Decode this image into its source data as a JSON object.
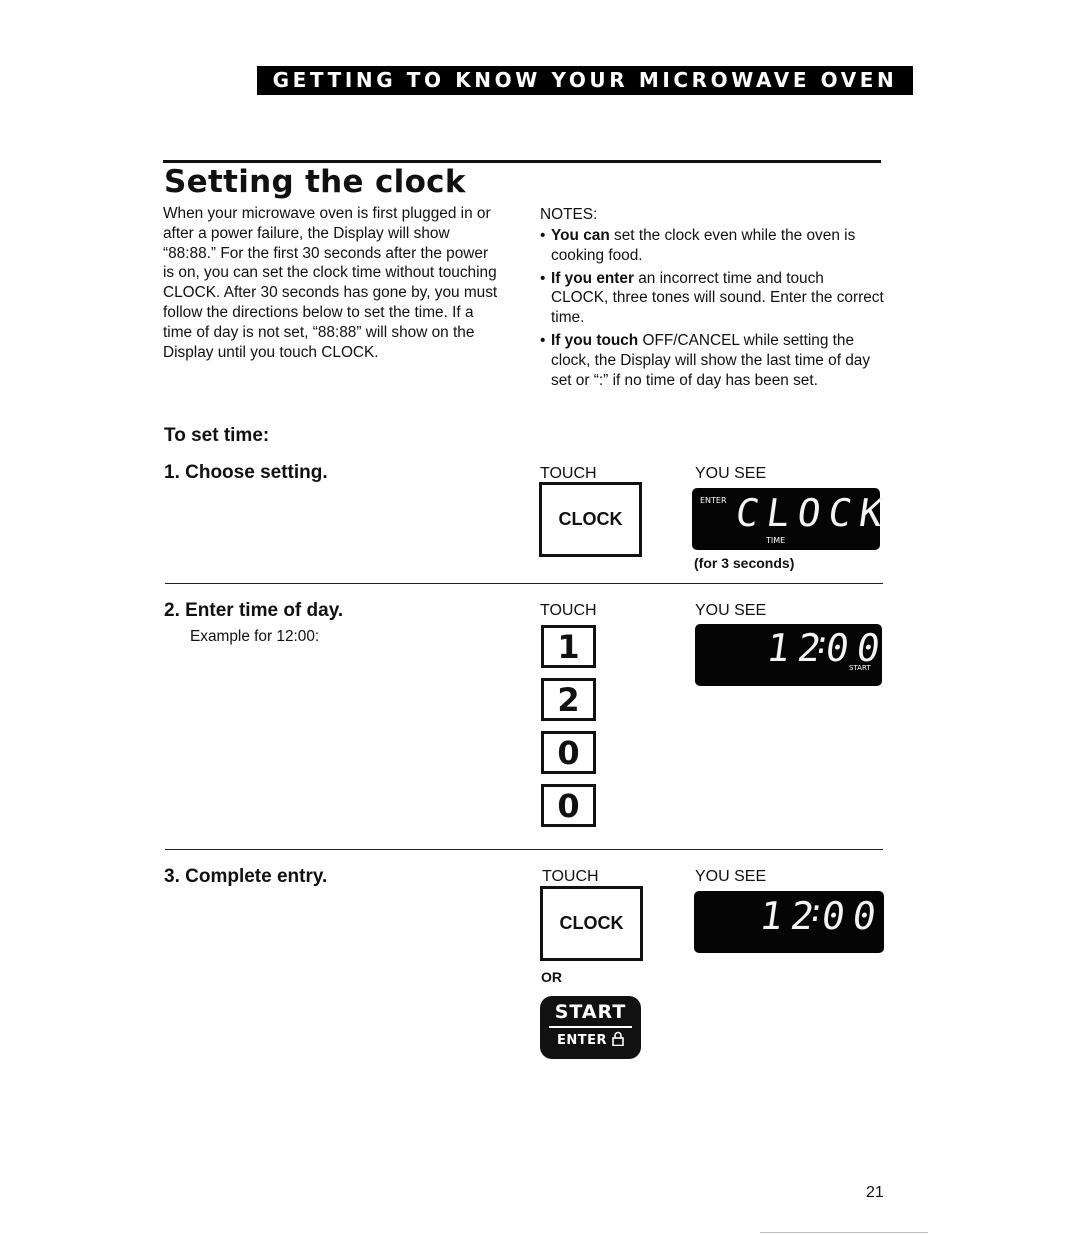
{
  "header": {
    "banner": "GETTING TO KNOW YOUR MICROWAVE OVEN"
  },
  "section": {
    "title": "Setting the clock",
    "intro": "When your microwave oven is first plugged in or after a power failure, the Display will show “88:88.” For the first 30 seconds after the power is on, you can set the clock time without touching CLOCK. After 30 seconds has gone by, you must follow the directions below to set the time. If a time of day is not set, “88:88” will show on the Display until you touch CLOCK."
  },
  "notes": {
    "heading": "NOTES:",
    "items": [
      {
        "bold": "You can",
        "text": " set the clock even while the oven is cooking food."
      },
      {
        "bold": "If you enter",
        "text": " an incorrect time and touch CLOCK, three tones will sound. Enter the correct time."
      },
      {
        "bold": "If you touch",
        "text": " OFF/CANCEL while setting the clock, the Display will show the last time of day set or “:” if no time of day has been set."
      }
    ]
  },
  "procedure": {
    "heading": "To set time:",
    "touch_label": "TOUCH",
    "you_see_label": "YOU SEE",
    "steps": [
      {
        "title": "1. Choose setting.",
        "key": "CLOCK",
        "display": {
          "text": "CLOCK",
          "indicator_top": "ENTER",
          "indicator_bottom": "TIME"
        },
        "caption": "(for 3 seconds)"
      },
      {
        "title": "2. Enter time of day.",
        "subtitle": "Example for 12:00:",
        "keys": [
          "1",
          "2",
          "0",
          "0"
        ],
        "display": {
          "hours": "12",
          "sep": ":",
          "minutes": "00",
          "indicator": "START"
        }
      },
      {
        "title": "3. Complete entry.",
        "key": "CLOCK",
        "or_label": "OR",
        "start_button": {
          "top": "START",
          "bottom": "ENTER"
        },
        "display": {
          "hours": "12",
          "sep": ":",
          "minutes": "00"
        }
      }
    ]
  },
  "footer": {
    "page_number": "21"
  }
}
